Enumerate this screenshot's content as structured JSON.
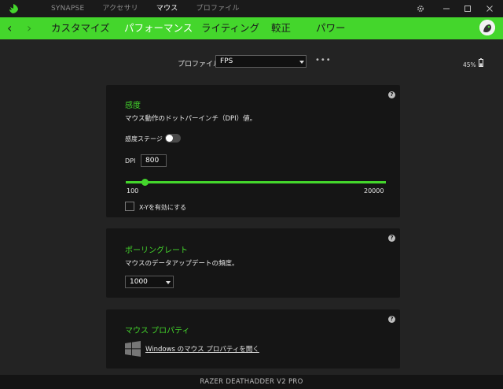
{
  "app": {
    "top_nav": [
      "SYNAPSE",
      "アクセサリ",
      "マウス",
      "プロファイル"
    ],
    "active_top_nav": "マウス"
  },
  "window_controls": [
    "gear-icon",
    "minimize-icon",
    "maximize-icon",
    "close-icon"
  ],
  "nav": {
    "back_label": "‹",
    "forward_label": "›",
    "tabs": [
      "カスタマイズ",
      "パフォーマンス",
      "ライティング",
      "較正",
      "パワー"
    ],
    "active_tab": "パフォーマンス"
  },
  "profile": {
    "label": "プロファイル",
    "value": "FPS",
    "more": "•••"
  },
  "battery": {
    "percent_text": "45%",
    "level": 0.45
  },
  "sensitivity": {
    "title": "感度",
    "desc": "マウス動作のドットパーインチ（DPI）値。",
    "stages_label": "感度ステージ",
    "stages_enabled": false,
    "dpi_label": "DPI",
    "dpi_value": "800",
    "slider_min": "100",
    "slider_max": "20000",
    "slider_value": 800,
    "xy_label": "X-Yを有効にする",
    "xy_checked": false,
    "help": "?"
  },
  "polling": {
    "title": "ポーリングレート",
    "desc": "マウスのデータアップデートの頻度。",
    "value": "1000",
    "help": "?"
  },
  "mouse_props": {
    "title": "マウス プロパティ",
    "link": "Windows のマウス プロパティを開く",
    "help": "?"
  },
  "footer": {
    "device": "RAZER DEATHADDER V2 PRO"
  },
  "colors": {
    "accent": "#44d62c",
    "background": "#222222",
    "card": "#151515"
  }
}
